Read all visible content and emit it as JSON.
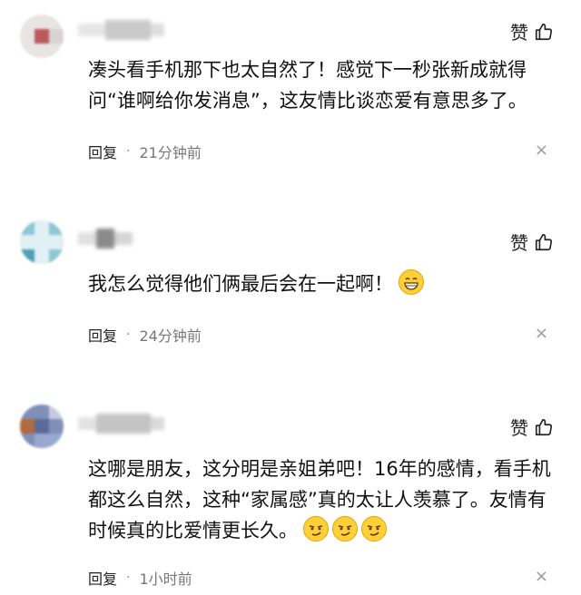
{
  "comments": [
    {
      "like_label": "赞",
      "text": "凑头看手机那下也太自然了！感觉下一秒张新成就得问“谁啊给你发消息”，这友情比谈恋爱有意思多了。",
      "reply_label": "回复",
      "time": "21分钟前",
      "close": "×"
    },
    {
      "like_label": "赞",
      "text": "我怎么觉得他们俩最后会在一起啊！",
      "reply_label": "回复",
      "time": "24分钟前",
      "close": "×",
      "emoji": [
        "grinning-face-emoji"
      ]
    },
    {
      "like_label": "赞",
      "text": "这哪是朋友，这分明是亲姐弟吧！16年的感情，看手机都这么自然，这种“家属感”真的太让人羡慕了。友情有时候真的比爱情更长久。",
      "reply_label": "回复",
      "time": "1小时前",
      "close": "×",
      "emoji": [
        "smirking-face-emoji",
        "smirking-face-emoji",
        "smirking-face-emoji"
      ]
    }
  ],
  "colors": {
    "text": "#111111",
    "meta": "#777777",
    "emoji_face": "#ffcf3a"
  }
}
